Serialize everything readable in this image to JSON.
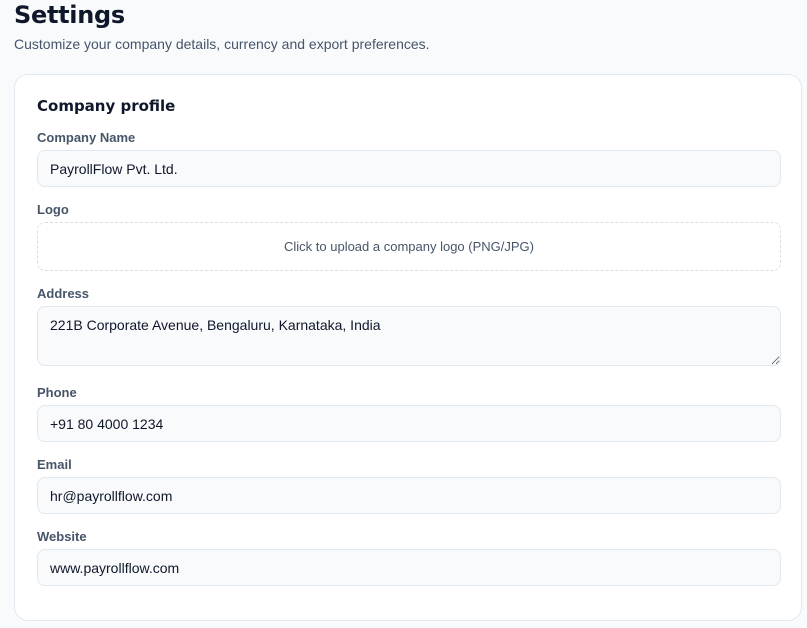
{
  "header": {
    "title": "Settings",
    "subtitle": "Customize your company details, currency and export preferences."
  },
  "company_profile": {
    "title": "Company profile",
    "company_name": {
      "label": "Company Name",
      "value": "PayrollFlow Pvt. Ltd."
    },
    "logo": {
      "label": "Logo",
      "upload_text": "Click to upload a company logo (PNG/JPG)"
    },
    "address": {
      "label": "Address",
      "value": "221B Corporate Avenue, Bengaluru, Karnataka, India"
    },
    "phone": {
      "label": "Phone",
      "value": "+91 80 4000 1234"
    },
    "email": {
      "label": "Email",
      "value": "hr@payrollflow.com"
    },
    "website": {
      "label": "Website",
      "value": "www.payrollflow.com"
    }
  }
}
